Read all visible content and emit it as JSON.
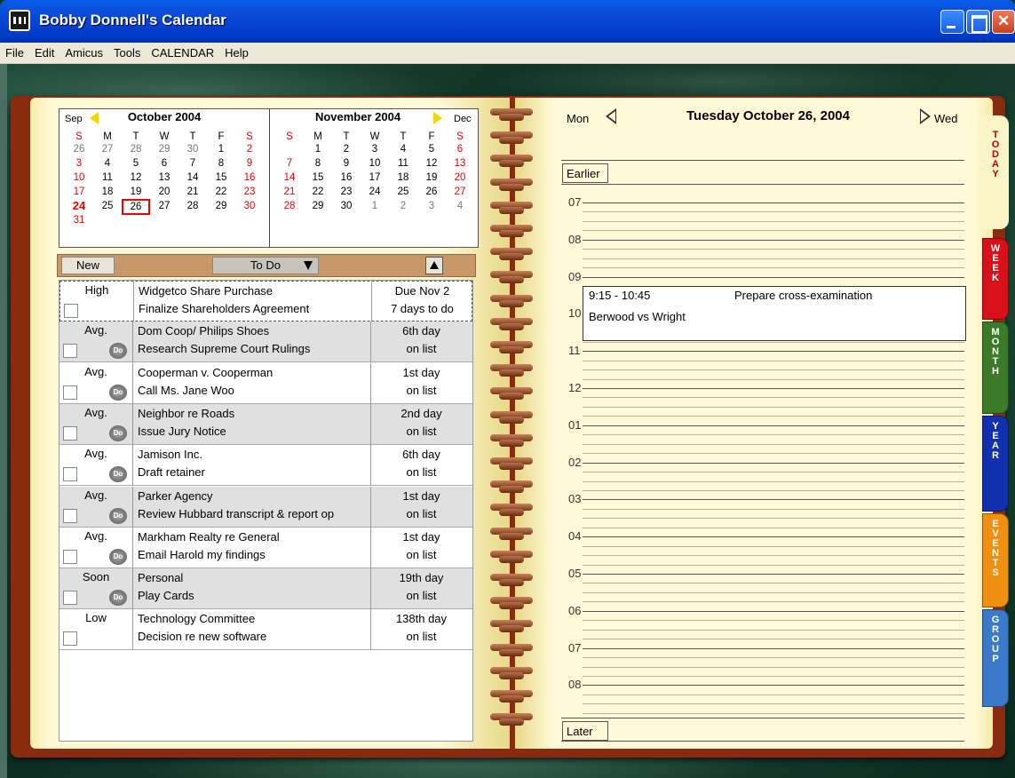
{
  "window": {
    "title": "Bobby Donnell's Calendar"
  },
  "menu": [
    "File",
    "Edit",
    "Amicus",
    "Tools",
    "CALENDAR",
    "Help"
  ],
  "mini_calendars": {
    "prev_label": "Sep",
    "next_label": "Dec",
    "october": {
      "title": "October 2004",
      "weekdays": [
        "S",
        "M",
        "T",
        "W",
        "T",
        "F",
        "S"
      ],
      "weeks": [
        [
          "26",
          "27",
          "28",
          "29",
          "30",
          "1",
          "2"
        ],
        [
          "3",
          "4",
          "5",
          "6",
          "7",
          "8",
          "9"
        ],
        [
          "10",
          "11",
          "12",
          "13",
          "14",
          "15",
          "16"
        ],
        [
          "17",
          "18",
          "19",
          "20",
          "21",
          "22",
          "23"
        ],
        [
          "24",
          "25",
          "26",
          "27",
          "28",
          "29",
          "30"
        ],
        [
          "31",
          "",
          "",
          "",
          "",
          "",
          ""
        ]
      ]
    },
    "november": {
      "title": "November 2004",
      "weekdays": [
        "S",
        "M",
        "T",
        "W",
        "T",
        "F",
        "S"
      ],
      "weeks": [
        [
          "",
          "1",
          "2",
          "3",
          "4",
          "5",
          "6"
        ],
        [
          "7",
          "8",
          "9",
          "10",
          "11",
          "12",
          "13"
        ],
        [
          "14",
          "15",
          "16",
          "17",
          "18",
          "19",
          "20"
        ],
        [
          "21",
          "22",
          "23",
          "24",
          "25",
          "26",
          "27"
        ],
        [
          "28",
          "29",
          "30",
          "1",
          "2",
          "3",
          "4"
        ]
      ]
    }
  },
  "todo": {
    "new_label": "New",
    "filter_label": "To Do",
    "items": [
      {
        "priority": "High",
        "line1": "Widgetco Share Purchase",
        "line2": "Finalize Shareholders Agreement",
        "due1": "Due Nov 2",
        "due2": "7 days to do",
        "icon": false
      },
      {
        "priority": "Avg.",
        "line1": "Dom Coop/ Philips Shoes",
        "line2": "Research Supreme Court Rulings",
        "due1": "6th day",
        "due2": "on list",
        "icon": true
      },
      {
        "priority": "Avg.",
        "line1": "Cooperman v. Cooperman",
        "line2": "Call  Ms. Jane Woo",
        "due1": "1st day",
        "due2": "on list",
        "icon": true
      },
      {
        "priority": "Avg.",
        "line1": "Neighbor re Roads",
        "line2": "Issue Jury Notice",
        "due1": "2nd day",
        "due2": "on list",
        "icon": true
      },
      {
        "priority": "Avg.",
        "line1": "Jamison Inc.",
        "line2": "Draft retainer",
        "due1": "6th day",
        "due2": "on list",
        "icon": true
      },
      {
        "priority": "Avg.",
        "line1": "Parker Agency",
        "line2": "Review Hubbard transcript & report op",
        "due1": "1st day",
        "due2": "on list",
        "icon": true
      },
      {
        "priority": "Avg.",
        "line1": "Markham Realty re General",
        "line2": "Email Harold my findings",
        "due1": "1st day",
        "due2": "on list",
        "icon": true
      },
      {
        "priority": "Soon",
        "line1": "Personal",
        "line2": "Play Cards",
        "due1": "19th day",
        "due2": "on list",
        "icon": true
      },
      {
        "priority": "Low",
        "line1": "Technology Committee",
        "line2": "Decision re new software",
        "due1": "138th day",
        "due2": "on list",
        "icon": false
      }
    ],
    "do_icon_text": "Do"
  },
  "day": {
    "prev_label": "Mon",
    "next_label": "Wed",
    "title": "Tuesday October 26, 2004",
    "earlier_label": "Earlier",
    "later_label": "Later",
    "hours": [
      "07",
      "08",
      "09",
      "10",
      "11",
      "12",
      "01",
      "02",
      "03",
      "04",
      "05",
      "06",
      "07",
      "08"
    ],
    "appointment": {
      "time": "9:15 - 10:45",
      "description": "Prepare cross-examination",
      "matter": "Berwood vs Wright"
    }
  },
  "tabs": [
    {
      "label": "TODAY",
      "color": "#fbf5c8",
      "text_color": "#c00000"
    },
    {
      "label": "WEEK",
      "color": "#d8101a",
      "text_color": "#ffffff"
    },
    {
      "label": "MONTH",
      "color": "#3a7a28",
      "text_color": "#ffffff"
    },
    {
      "label": "YEAR",
      "color": "#1030b0",
      "text_color": "#ffffff"
    },
    {
      "label": "EVENTS",
      "color": "#f09010",
      "text_color": "#ffffff"
    },
    {
      "label": "GROUP",
      "color": "#3a7ac8",
      "text_color": "#ffffff"
    }
  ]
}
